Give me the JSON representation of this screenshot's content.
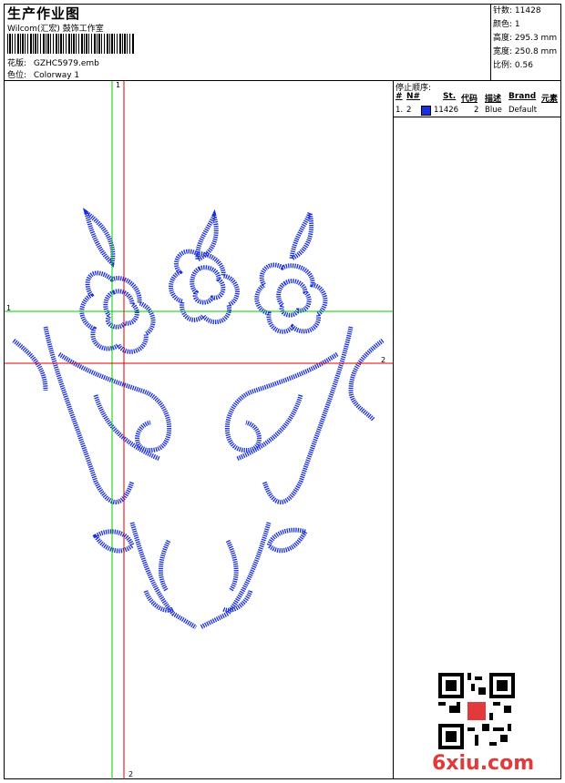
{
  "header": {
    "title": "生产作业图",
    "company": "Wilcom(汇宏) 鼓饰工作室",
    "pattern_label": "花版:",
    "pattern_value": "GZHC5979.emb",
    "colorway_label": "色位:",
    "colorway_value": "Colorway 1"
  },
  "stats": {
    "stitches_label": "针数:",
    "stitches_value": "11428",
    "colors_label": "颜色:",
    "colors_value": "1",
    "height_label": "高度:",
    "height_value": "295.3 mm",
    "width_label": "宽度:",
    "width_value": "250.8 mm",
    "scale_label": "比例:",
    "scale_value": "0.56"
  },
  "stop_sequence": {
    "title": "停止顺序:",
    "columns": [
      "#",
      "N#",
      "St.",
      "代码",
      "描述",
      "Brand",
      "元素"
    ],
    "rows": [
      {
        "num": "1.",
        "needle": "2",
        "stitches": "11426",
        "code": "2",
        "desc": "Blue",
        "brand": "Default",
        "swatch_color": "#1a2fe0"
      }
    ]
  },
  "guides": {
    "green_v_label": "1",
    "green_h_label": "1",
    "red_h_label": "2",
    "red_v_label": "2"
  },
  "colors": {
    "thread": "#1a2fe0",
    "guide_green": "#00cc00",
    "guide_red": "#e00000",
    "watermark": "#e23a3a"
  },
  "watermark": "6xiu.com"
}
